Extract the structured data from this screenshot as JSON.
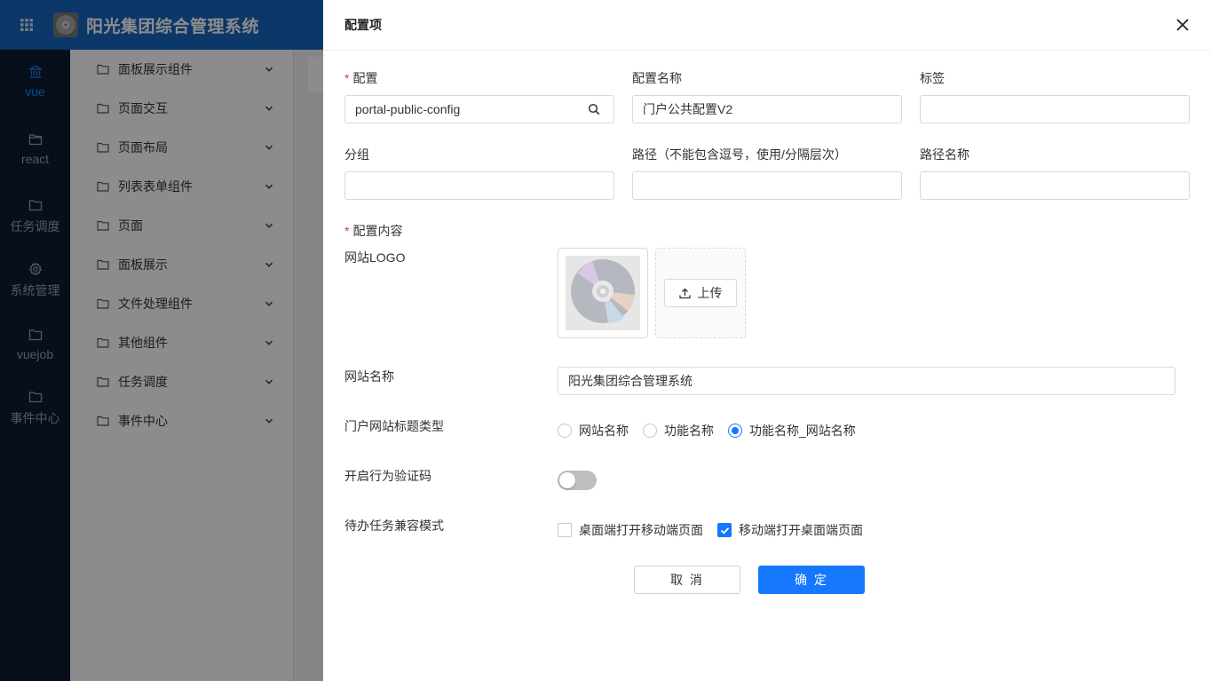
{
  "app": {
    "title": "阳光集团综合管理系统"
  },
  "leftnav": [
    {
      "label": "vue",
      "icon": "bank-icon",
      "active": true
    },
    {
      "label": "react",
      "icon": "folder-icon"
    },
    {
      "label": "任务调度",
      "icon": "folder-icon"
    },
    {
      "label": "系统管理",
      "icon": "gear-icon"
    },
    {
      "label": "vuejob",
      "icon": "folder-icon"
    },
    {
      "label": "事件中心",
      "icon": "folder-icon"
    }
  ],
  "submenu": [
    "面板展示组件",
    "页面交互",
    "页面布局",
    "列表表单组件",
    "页面",
    "面板展示",
    "文件处理组件",
    "其他组件",
    "任务调度",
    "事件中心"
  ],
  "drawer": {
    "title": "配置项",
    "config": {
      "label": "配置",
      "value": "portal-public-config"
    },
    "config_name": {
      "label": "配置名称",
      "value": "门户公共配置V2"
    },
    "tag": {
      "label": "标签",
      "value": ""
    },
    "group": {
      "label": "分组",
      "value": ""
    },
    "path": {
      "label": "路径（不能包含逗号，使用/分隔层次）",
      "value": ""
    },
    "path_name": {
      "label": "路径名称",
      "value": ""
    },
    "content_label": "配置内容",
    "logo_label": "网站LOGO",
    "upload_label": "上传",
    "site_name": {
      "label": "网站名称",
      "value": "阳光集团综合管理系统"
    },
    "title_type": {
      "label": "门户网站标题类型",
      "options": [
        "网站名称",
        "功能名称",
        "功能名称_网站名称"
      ],
      "selected": 2
    },
    "captcha": {
      "label": "开启行为验证码",
      "on": false
    },
    "todo_mode": {
      "label": "待办任务兼容模式",
      "options": [
        {
          "label": "桌面端打开移动端页面",
          "checked": false
        },
        {
          "label": "移动端打开桌面端页面",
          "checked": true
        }
      ]
    },
    "cancel_label": "取 消",
    "ok_label": "确 定"
  },
  "colors": {
    "topbar": "#1565c0",
    "nav_bg": "#0d1b33",
    "primary": "#1677ff",
    "required": "#e53935"
  }
}
